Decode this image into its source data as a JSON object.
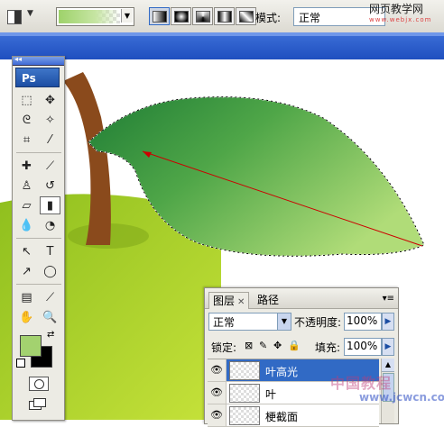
{
  "options_bar": {
    "tool_preset_icon": "gradient-tool-icon",
    "gradient_types": [
      "linear-gradient",
      "radial-gradient",
      "angle-gradient",
      "reflected-gradient",
      "diamond-gradient"
    ],
    "active_gradient_type": 0,
    "mode_label": "模式:",
    "mode_value": "正常",
    "watermark_text": "网页教学网",
    "watermark_url": "www.webjx.com"
  },
  "toolbox": {
    "logo": "Ps",
    "tools": [
      "marquee-tool",
      "move-tool",
      "lasso-tool",
      "magic-wand-tool",
      "crop-tool",
      "slice-tool",
      "healing-brush-tool",
      "brush-tool",
      "clone-stamp-tool",
      "history-brush-tool",
      "eraser-tool",
      "gradient-tool",
      "blur-tool",
      "dodge-tool",
      "path-selection-tool",
      "type-tool",
      "direct-selection-tool",
      "ellipse-tool",
      "notes-tool",
      "eyedropper-tool",
      "hand-tool",
      "zoom-tool"
    ],
    "type_glyph": "T",
    "foreground_color": "#a3d26f",
    "background_color": "#000000"
  },
  "layers_panel": {
    "tab_layers": "图层",
    "tab_paths": "路径",
    "blend_mode": "正常",
    "opacity_label": "不透明度:",
    "opacity_value": "100%",
    "lock_label": "锁定:",
    "fill_label": "填充:",
    "fill_value": "100%",
    "layers": [
      {
        "name": "叶高光",
        "selected": true
      },
      {
        "name": "叶",
        "selected": false
      },
      {
        "name": "梗截面",
        "selected": false
      }
    ]
  },
  "watermark": {
    "cn": "中国教程",
    "url": "www.jcwcn.com"
  },
  "colors": {
    "leaf_dark": "#2e8b3e",
    "leaf_light": "#a6d86c",
    "apple": "#a8cf24",
    "stem": "#8a4a1c",
    "gradient_line": "#cc0000"
  }
}
